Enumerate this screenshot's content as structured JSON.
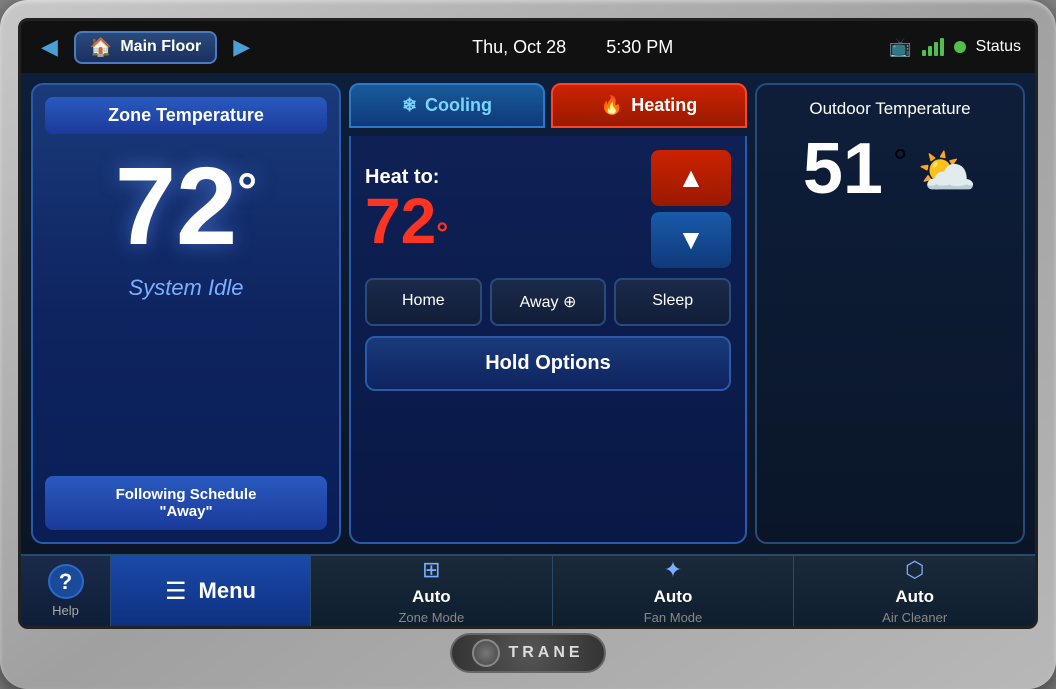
{
  "device": {
    "brand": "TRANE"
  },
  "topbar": {
    "location": "Main Floor",
    "date": "Thu, Oct 28",
    "time": "5:30 PM",
    "status_label": "Status",
    "nav_left": "◀",
    "nav_right": "▶"
  },
  "zone_panel": {
    "title": "Zone Temperature",
    "temperature": "72",
    "degree_symbol": "°",
    "status": "System Idle",
    "schedule": "Following Schedule\n\"Away\""
  },
  "mode_tabs": {
    "cooling_label": "Cooling",
    "heating_label": "Heating"
  },
  "control": {
    "heat_to_label": "Heat to:",
    "set_temp": "72",
    "degree": "°",
    "btn_up": "▲",
    "btn_down": "▼",
    "mode_home": "Home",
    "mode_away": "Away",
    "mode_sleep": "Sleep",
    "hold_options": "Hold Options"
  },
  "outdoor_panel": {
    "title": "Outdoor Temperature",
    "temperature": "51",
    "degree": "°"
  },
  "bottom_bar": {
    "help_label": "Help",
    "help_symbol": "?",
    "menu_label": "Menu",
    "zone_mode_main": "Auto",
    "zone_mode_sub": "Zone Mode",
    "fan_mode_main": "Auto",
    "fan_mode_sub": "Fan Mode",
    "air_cleaner_main": "Auto",
    "air_cleaner_sub": "Air Cleaner"
  }
}
